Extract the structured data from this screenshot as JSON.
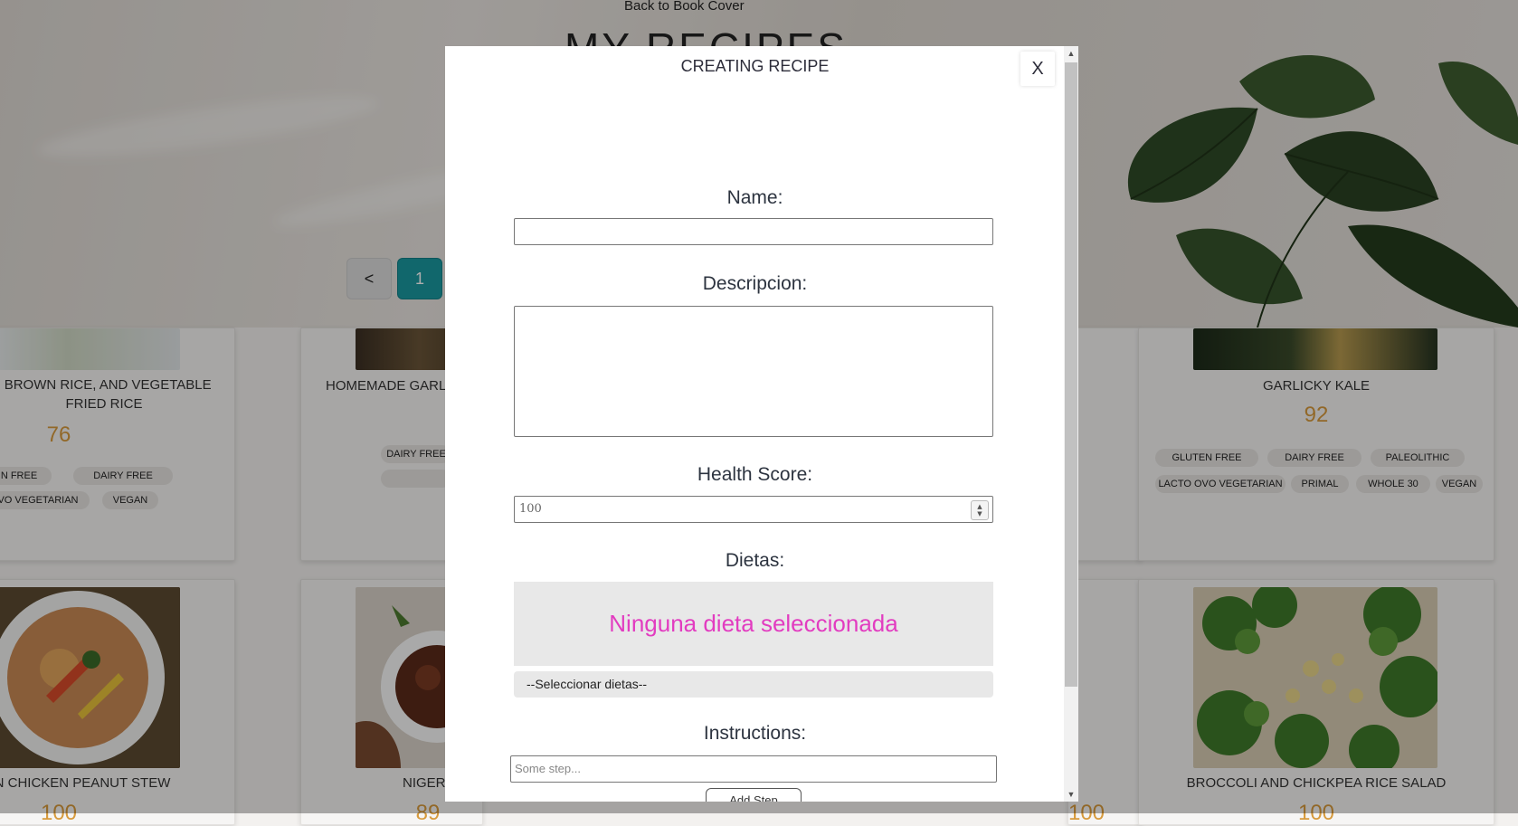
{
  "background": {
    "back_link": "Back to Book Cover",
    "page_title": "MY RECIPES",
    "pager": {
      "prev": "<",
      "current": "1"
    },
    "cards": [
      {
        "title": ", BROWN RICE, AND VEGETABLE FRIED RICE",
        "score": "76",
        "tags": [
          "N FREE",
          "DAIRY FREE",
          "VO VEGETARIAN",
          "VEGAN"
        ]
      },
      {
        "title": "HOMEMADE GARL",
        "score": "",
        "tags": [
          "DAIRY FREE",
          ""
        ]
      },
      {
        "title": "GARLICKY KALE",
        "score": "92",
        "tags": [
          "GLUTEN FREE",
          "DAIRY FREE",
          "PALEOLITHIC",
          "LACTO OVO VEGETARIAN",
          "PRIMAL",
          "WHOLE 30",
          "VEGAN"
        ]
      },
      {
        "title": "N CHICKEN PEANUT STEW",
        "score": "100",
        "tags": []
      },
      {
        "title": "NIGER",
        "score": "89",
        "tags": []
      },
      {
        "title": "",
        "score": "100",
        "tags": []
      },
      {
        "title": "BROCCOLI AND CHICKPEA RICE SALAD",
        "score": "100",
        "tags": []
      }
    ]
  },
  "modal": {
    "title": "CREATING RECIPE",
    "close_label": "X",
    "name_label": "Name:",
    "name_value": "",
    "description_label": "Descripcion:",
    "description_value": "",
    "health_label": "Health Score:",
    "health_value": "100",
    "diets_label": "Dietas:",
    "diets_empty": "Ninguna dieta seleccionada",
    "diets_select": "--Seleccionar dietas--",
    "instructions_label": "Instructions:",
    "step_placeholder": "Some step...",
    "add_step_label": "Add Step"
  },
  "colors": {
    "accent": "#1a98a0",
    "score": "#d79a3c",
    "diet_empty": "#e23cc0"
  }
}
